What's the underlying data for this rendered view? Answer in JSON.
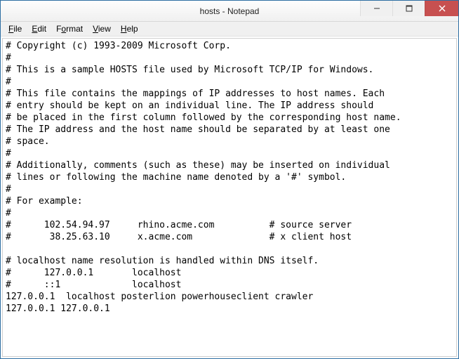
{
  "window": {
    "title": "hosts - Notepad"
  },
  "controls": {
    "minimize": "minimize",
    "maximize": "maximize",
    "close": "close"
  },
  "menu": {
    "file": {
      "label": "File",
      "accel": "F"
    },
    "edit": {
      "label": "Edit",
      "accel": "E"
    },
    "format": {
      "label": "Format",
      "accel": "o"
    },
    "view": {
      "label": "View",
      "accel": "V"
    },
    "help": {
      "label": "Help",
      "accel": "H"
    }
  },
  "editor": {
    "content": "# Copyright (c) 1993-2009 Microsoft Corp.\n#\n# This is a sample HOSTS file used by Microsoft TCP/IP for Windows.\n#\n# This file contains the mappings of IP addresses to host names. Each\n# entry should be kept on an individual line. The IP address should\n# be placed in the first column followed by the corresponding host name.\n# The IP address and the host name should be separated by at least one\n# space.\n#\n# Additionally, comments (such as these) may be inserted on individual\n# lines or following the machine name denoted by a '#' symbol.\n#\n# For example:\n#\n#      102.54.94.97     rhino.acme.com          # source server\n#       38.25.63.10     x.acme.com              # x client host\n\n# localhost name resolution is handled within DNS itself.\n#      127.0.0.1       localhost\n#      ::1             localhost\n127.0.0.1  localhost posterlion powerhouseclient crawler\n127.0.0.1 127.0.0.1"
  }
}
